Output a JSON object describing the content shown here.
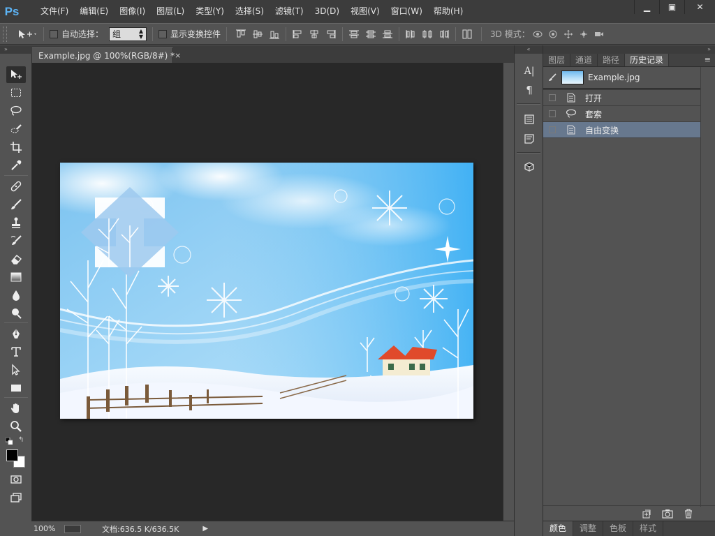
{
  "app": {
    "logo": "Ps"
  },
  "menu": [
    "文件(F)",
    "编辑(E)",
    "图像(I)",
    "图层(L)",
    "类型(Y)",
    "选择(S)",
    "滤镜(T)",
    "3D(D)",
    "视图(V)",
    "窗口(W)",
    "帮助(H)"
  ],
  "window_controls": {
    "minimize": "▁",
    "restore": "▣",
    "close": "✕"
  },
  "options": {
    "auto_select_label": "自动选择：",
    "auto_select_value": "组",
    "show_transform_label": "显示变换控件",
    "mode_3d_label": "3D 模式："
  },
  "document": {
    "tab_title": "Example.jpg @ 100%(RGB/8#) *",
    "tab_close": "×"
  },
  "status": {
    "zoom": "100%",
    "doc_size": "文档:636.5 K/636.5K",
    "arrow": "▶"
  },
  "history_panel": {
    "tabs": [
      "图层",
      "通道",
      "路径",
      "历史记录"
    ],
    "active_tab": "历史记录",
    "snapshot_name": "Example.jpg",
    "items": [
      {
        "label": "打开",
        "icon": "document-icon"
      },
      {
        "label": "套索",
        "icon": "lasso-icon"
      },
      {
        "label": "自由变换",
        "icon": "document-icon"
      }
    ],
    "selected_item": "自由变换"
  },
  "bottom_tabs": [
    "颜色",
    "调整",
    "色板",
    "样式"
  ],
  "bottom_active_tab": "颜色",
  "panel_strip": {
    "char": "A|",
    "para": "¶"
  }
}
